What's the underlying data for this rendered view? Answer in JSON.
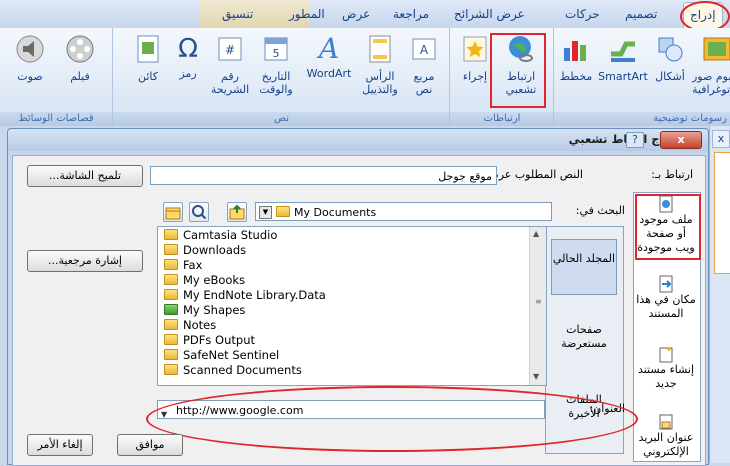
{
  "ribbon": {
    "tabs": {
      "insert": "إدراج",
      "design": "تصميم",
      "animations": "حركات",
      "slideshow": "عرض الشرائح",
      "review": "مراجعة",
      "view": "عرض",
      "developer": "المطور",
      "format": "تنسيق"
    },
    "groups": {
      "illustrations": "رسومات توضيحية",
      "links": "ارتباطات",
      "text": "نص",
      "media": "قصاصات الوسائط"
    },
    "buttons": {
      "photo_album": "ألبوم صور",
      "photo_album_2": "فوتوغرافية",
      "shapes": "أشكال",
      "smartart": "SmartArt",
      "chart": "مخطط",
      "hyperlink_line1": "ارتباط",
      "hyperlink_line2": "تشعبي",
      "action": "إجراء",
      "textbox_line1": "مربع",
      "textbox_line2": "نص",
      "header_line1": "الرأس",
      "header_line2": "والتذييل",
      "wordart": "WordArt",
      "datetime_line1": "التاريخ",
      "datetime_line2": "والوقت",
      "slidenum_line1": "رقم",
      "slidenum_line2": "الشريحة",
      "symbol": "رمز",
      "object": "كائن",
      "movie": "فيلم",
      "sound": "صوت"
    }
  },
  "dialog": {
    "title": "إدراج ارتباط تشعبي",
    "help": "?",
    "close": "x",
    "link_to_label": "ارتباط بـ:",
    "text_to_display_label": "النص المطلوب عرضه:",
    "text_to_display_value": "موقع جوجل",
    "screentip_button": "تلميح الشاشة...",
    "look_in_label": "البحث في:",
    "look_in_value": "My Documents",
    "bookmark_button": "إشارة مرجعية...",
    "address_label": "العنوان:",
    "address_value": "http://www.google.com",
    "ok_button": "موافق",
    "cancel_button": "إلغاء الأمر",
    "link_to_items": [
      "ملف موجود أو صفحة ويب موجودة",
      "مكان في هذا المستند",
      "إنشاء مستند جديد",
      "عنوان البريد الإلكتروني"
    ],
    "browse_items": [
      "المجلد الحالي",
      "صفحات مستعرضة",
      "الملفات الأخيرة"
    ],
    "files": [
      "Camtasia Studio",
      "Downloads",
      "Fax",
      "My eBooks",
      "My EndNote Library.Data",
      "My Shapes",
      "Notes",
      "PDFs Output",
      "SafeNet Sentinel",
      "Scanned Documents"
    ]
  },
  "side_panel": {
    "tab": "x"
  },
  "colors": {
    "annotation_red": "#e0262c",
    "ribbon_text": "#15428b",
    "dialog_frame": "#c4d5ec"
  }
}
